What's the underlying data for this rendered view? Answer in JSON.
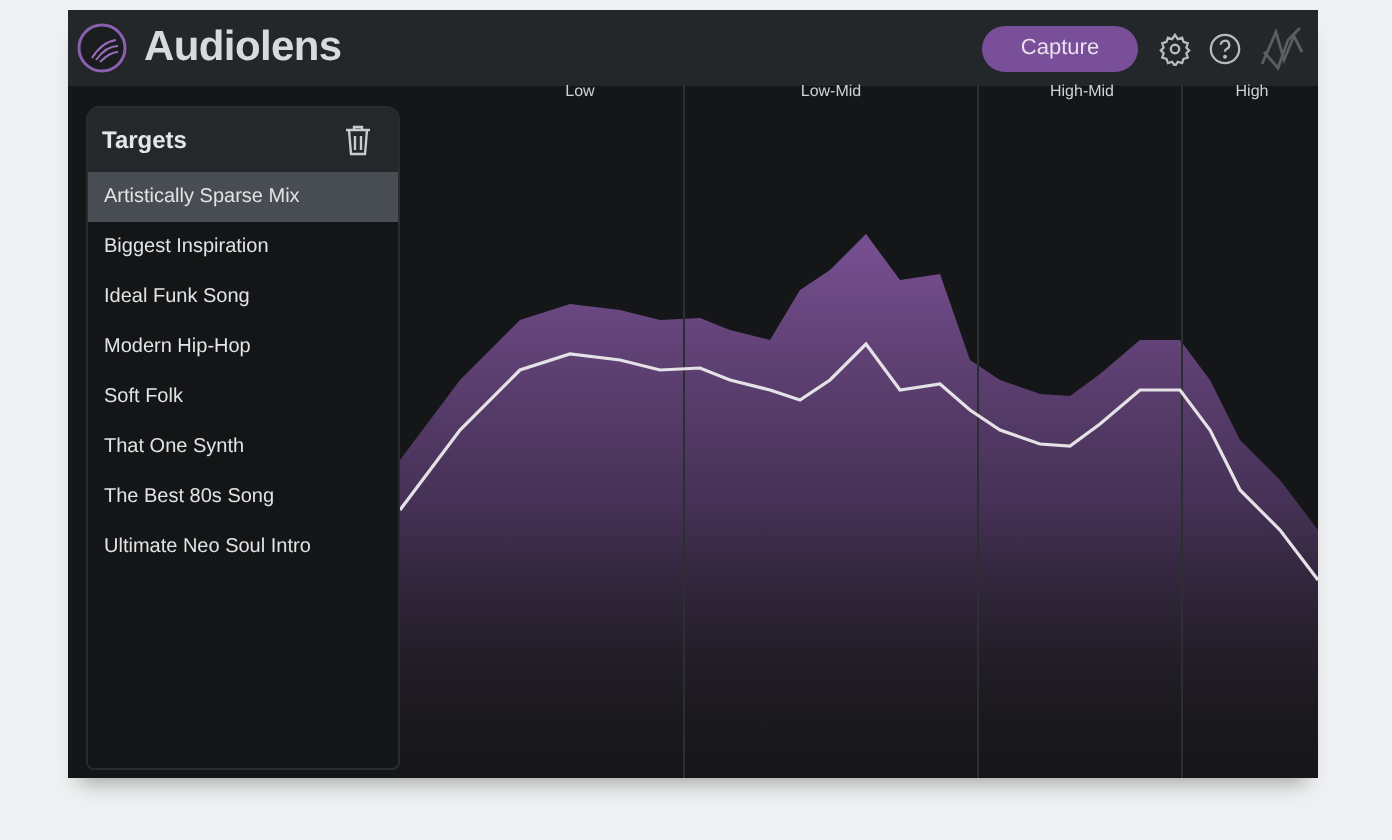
{
  "app": {
    "title": "Audiolens",
    "capture_button": "Capture"
  },
  "targets": {
    "title": "Targets",
    "items": [
      {
        "label": "Artistically Sparse Mix",
        "selected": true
      },
      {
        "label": "Biggest Inspiration",
        "selected": false
      },
      {
        "label": "Ideal Funk Song",
        "selected": false
      },
      {
        "label": "Modern Hip-Hop",
        "selected": false
      },
      {
        "label": "Soft Folk",
        "selected": false
      },
      {
        "label": "That One Synth",
        "selected": false
      },
      {
        "label": "The Best 80s Song",
        "selected": false
      },
      {
        "label": "Ultimate Neo Soul Intro",
        "selected": false
      }
    ]
  },
  "bands": [
    "Low",
    "Low-Mid",
    "High-Mid",
    "High"
  ]
}
